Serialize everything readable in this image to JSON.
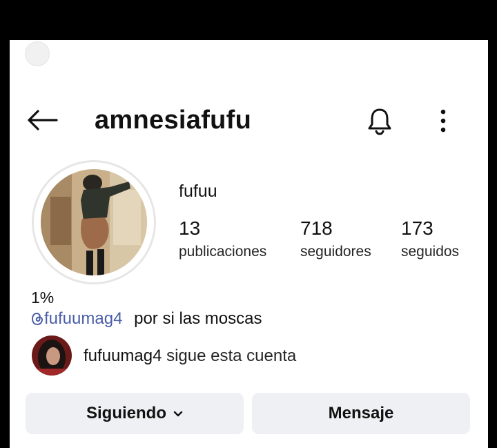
{
  "header": {
    "username": "amnesiafufu",
    "icons": {
      "back": "arrow-left-icon",
      "notifications": "bell-icon",
      "more": "vertical-dots-icon"
    }
  },
  "profile": {
    "display_name": "fufuu",
    "stats": [
      {
        "value": "13",
        "label": "publicaciones"
      },
      {
        "value": "718",
        "label": "seguidores"
      },
      {
        "value": "173",
        "label": "seguidos"
      }
    ],
    "bio_line1": "1%",
    "bio_link": "fufuumag4",
    "bio_text": "por si las moscas",
    "mutual": {
      "username": "fufuumag4",
      "text": "sigue esta cuenta"
    }
  },
  "actions": {
    "following_label": "Siguiendo",
    "message_label": "Mensaje"
  },
  "colors": {
    "link": "#4a5da8",
    "button_bg": "#eff0f3",
    "frame": "#000000"
  }
}
